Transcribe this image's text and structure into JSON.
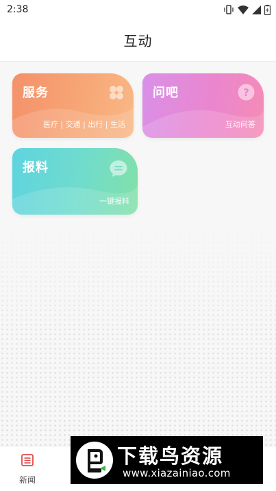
{
  "status_bar": {
    "time": "2:38",
    "icons": [
      "vibrate-icon",
      "wifi-icon",
      "signal-icon",
      "battery-icon"
    ]
  },
  "header": {
    "title": "互动"
  },
  "cards": [
    {
      "title": "服务",
      "subtitle": "医疗 | 交通 | 出行 | 生活",
      "icon": "clover-icon"
    },
    {
      "title": "问吧",
      "subtitle": "互动问答",
      "icon": "question-icon"
    },
    {
      "title": "报料",
      "subtitle": "一键报料",
      "icon": "chat-bubble-icon"
    }
  ],
  "bottom_nav": {
    "items": [
      {
        "label": "新闻",
        "icon": "news-icon",
        "color": "#e04b4b"
      }
    ]
  },
  "watermark": {
    "title": "下载鸟资源",
    "url": "www.xiazainiao.com"
  },
  "colors": {
    "service": "#f4916b",
    "ask": "#e58bd6",
    "report": "#66d7d2",
    "accent_red": "#e04b4b"
  }
}
